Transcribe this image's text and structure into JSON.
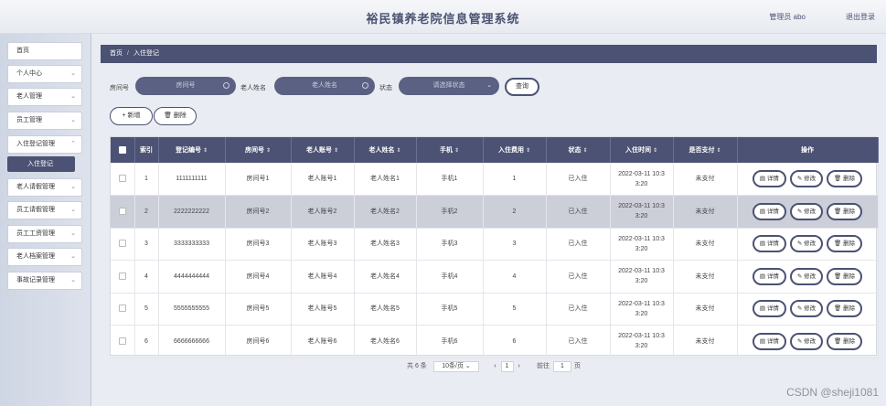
{
  "header": {
    "title": "裕民镇养老院信息管理系统",
    "user": "管理员 abo",
    "logout": "退出登录"
  },
  "sidebar": {
    "items": [
      {
        "label": "首页"
      },
      {
        "label": "个人中心"
      },
      {
        "label": "老人管理"
      },
      {
        "label": "员工管理"
      },
      {
        "label": "入住登记管理"
      },
      {
        "label": "入住登记"
      },
      {
        "label": "老人请假管理"
      },
      {
        "label": "员工请假管理"
      },
      {
        "label": "员工工资管理"
      },
      {
        "label": "老人档案管理"
      },
      {
        "label": "事故记录管理"
      }
    ]
  },
  "breadcrumb": {
    "home": "首页",
    "sep": "/",
    "current": "入住登记"
  },
  "search": {
    "room_label": "房间号",
    "room_placeholder": "房间号",
    "name_label": "老人姓名",
    "name_placeholder": "老人姓名",
    "status_label": "状态",
    "status_placeholder": "请选择状态",
    "query": "查询"
  },
  "actions": {
    "add": "+ 新增",
    "delete": "删除"
  },
  "table": {
    "headers": [
      "索引",
      "登记编号",
      "房间号",
      "老人账号",
      "老人姓名",
      "手机",
      "入住费用",
      "状态",
      "入住时间",
      "是否支付",
      "操作"
    ],
    "rows": [
      [
        "1",
        "1111111111",
        "房间号1",
        "老人账号1",
        "老人姓名1",
        "手机1",
        "1",
        "已入住",
        "2022-03-11 10:3",
        "3:20",
        "未支付"
      ],
      [
        "2",
        "2222222222",
        "房间号2",
        "老人账号2",
        "老人姓名2",
        "手机2",
        "2",
        "已入住",
        "2022-03-11 10:3",
        "3:20",
        "未支付"
      ],
      [
        "3",
        "3333333333",
        "房间号3",
        "老人账号3",
        "老人姓名3",
        "手机3",
        "3",
        "已入住",
        "2022-03-11 10:3",
        "3:20",
        "未支付"
      ],
      [
        "4",
        "4444444444",
        "房间号4",
        "老人账号4",
        "老人姓名4",
        "手机4",
        "4",
        "已入住",
        "2022-03-11 10:3",
        "3:20",
        "未支付"
      ],
      [
        "5",
        "5555555555",
        "房间号5",
        "老人账号5",
        "老人姓名5",
        "手机5",
        "5",
        "已入住",
        "2022-03-11 10:3",
        "3:20",
        "未支付"
      ],
      [
        "6",
        "6666666666",
        "房间号6",
        "老人账号6",
        "老人姓名6",
        "手机6",
        "6",
        "已入住",
        "2022-03-11 10:3",
        "3:20",
        "未支付"
      ]
    ],
    "row_actions": [
      "详情",
      "修改",
      "删除"
    ]
  },
  "pagination": {
    "total": "共 6 条",
    "page_size": "10条/页",
    "prev": "‹",
    "page": "1",
    "next": "›",
    "goto_label": "前往",
    "goto_value": "1",
    "goto_unit": "页"
  },
  "watermark": "CSDN @sheji1081"
}
